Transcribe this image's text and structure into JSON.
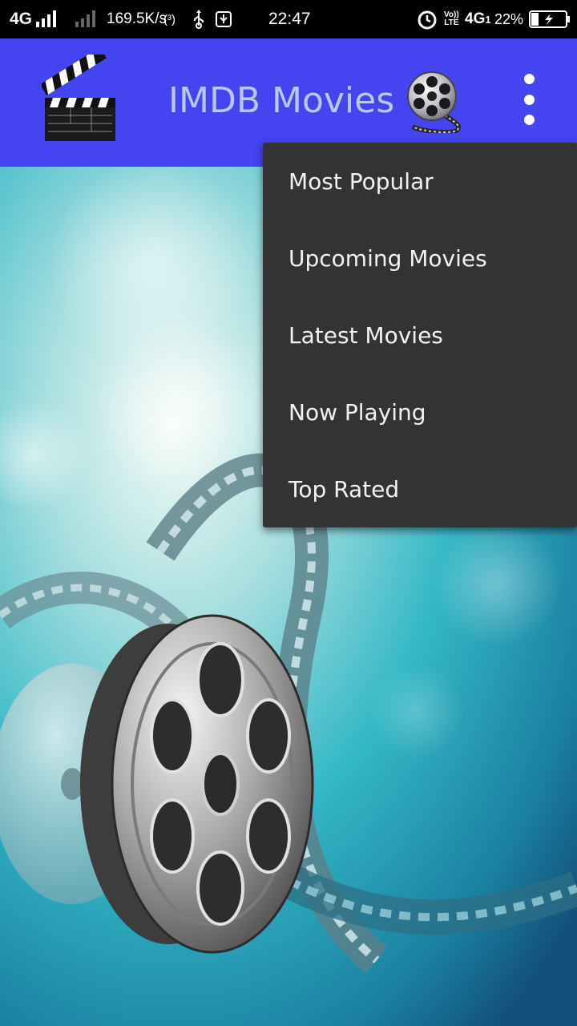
{
  "status_bar": {
    "network": "4G",
    "speed": "169.5K/s",
    "hotspot": "(³)",
    "time": "22:47",
    "volte_top": "Vo))",
    "volte_bottom": "LTE",
    "network2": "4G",
    "network2_sub": "1",
    "battery_percent": "22%",
    "icons": [
      "signal-icon",
      "signal-weak-icon",
      "hotspot-icon",
      "usb-icon",
      "usb-debug-icon",
      "alarm-icon",
      "battery-charging-icon"
    ]
  },
  "app_bar": {
    "title": "IMDB Movies",
    "color": "#4444f0",
    "title_color": "#b9c6ff",
    "logo_icon": "clapperboard-icon",
    "action_icon": "film-reel-icon",
    "overflow_icon": "more-vert-icon"
  },
  "menu": {
    "background": "#333333",
    "items": [
      {
        "label": "Most Popular"
      },
      {
        "label": "Upcoming Movies"
      },
      {
        "label": "Latest Movies"
      },
      {
        "label": "Now Playing"
      },
      {
        "label": "Top Rated"
      }
    ]
  },
  "background": {
    "description_icon": "film-reels-background",
    "colors": [
      "#8fd8e8",
      "#2fb8c8",
      "#1a6f95"
    ]
  }
}
